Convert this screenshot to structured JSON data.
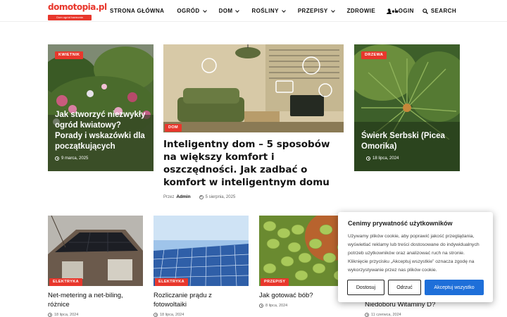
{
  "header": {
    "logo": "domotopia.pl",
    "logo_tagline": "Dom ogród harmonia",
    "nav": [
      {
        "label": "STRONA GŁÓWNA",
        "dropdown": false
      },
      {
        "label": "OGRÓD",
        "dropdown": true
      },
      {
        "label": "DOM",
        "dropdown": true
      },
      {
        "label": "ROŚLINY",
        "dropdown": true
      },
      {
        "label": "PRZEPISY",
        "dropdown": true
      },
      {
        "label": "ZDROWIE",
        "dropdown": false
      }
    ],
    "more": "•••",
    "login": "LOGIN",
    "search": "SEARCH"
  },
  "featured": {
    "left": {
      "tag": "KWIETNIK",
      "title": "Jak stworzyć niezwykły ogród kwiatowy? Porady i wskazówki dla początkujących",
      "date": "9 marca, 2025"
    },
    "center": {
      "tag": "DOM",
      "title": "Inteligentny dom – 5 sposobów na większy komfort i oszczędności. Jak zadbać o komfort w inteligentnym domu",
      "by": "Przez",
      "author": "Admin",
      "date": "5 sierpnia, 2025"
    },
    "right": {
      "tag": "DRZEWA",
      "title": "Świerk Serbski (Picea Omorika)",
      "date": "18 lipca, 2024"
    }
  },
  "small_cards": [
    {
      "tag": "ELEKTRYKA",
      "title": "Net-metering a net-biling, różnice",
      "date": "18 lipca, 2024"
    },
    {
      "tag": "ELEKTRYKA",
      "title": "Rozliczanie prądu z fotowoltaiki",
      "date": "18 lipca, 2024"
    },
    {
      "tag": "PRZEPISY",
      "title": "Jak gotować bób?",
      "date": "8 lipca, 2024"
    },
    {
      "tag": "",
      "title": "Niedoboru Witaminy D?",
      "date": "11 czerwca, 2024"
    }
  ],
  "cookie": {
    "title": "Cenimy prywatność użytkowników",
    "text": "Używamy plików cookie, aby poprawić jakość przeglądania, wyświetlać reklamy lub treści dostosowane do indywidualnych potrzeb użytkowników oraz analizować ruch na stronie. Kliknięcie przycisku „Akceptuj wszystkie” oznacza zgodę na wykorzystywanie przez nas plików cookie.",
    "customize": "Dostosuj",
    "reject": "Odrzuć",
    "accept": "Akceptuj wszystko"
  },
  "colors": {
    "accent": "#e8372c",
    "primary_button": "#1e6fd9"
  }
}
